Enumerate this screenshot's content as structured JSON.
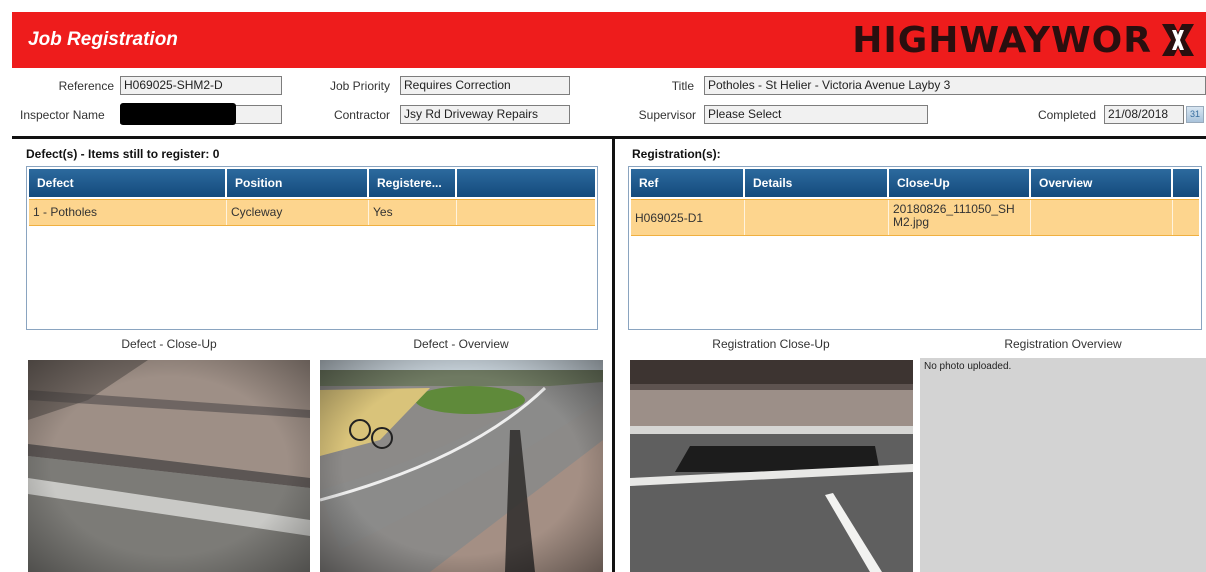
{
  "header": {
    "title": "Job Registration",
    "logo_text": "HIGHWAYWOR"
  },
  "form": {
    "reference_label": "Reference",
    "reference_value": "H069025-SHM2-D",
    "inspector_label": "Inspector Name",
    "priority_label": "Job Priority",
    "priority_value": "Requires Correction",
    "contractor_label": "Contractor",
    "contractor_value": "Jsy Rd Driveway Repairs",
    "title_label": "Title",
    "title_value": "Potholes - St Helier - Victoria Avenue Layby 3",
    "supervisor_label": "Supervisor",
    "supervisor_value": "Please Select",
    "completed_label": "Completed",
    "completed_value": "21/08/2018",
    "calendar_glyph": "31"
  },
  "defects": {
    "title": "Defect(s) - Items still to register: 0",
    "columns": [
      "Defect",
      "Position",
      "Registere..."
    ],
    "rows": [
      {
        "defect": "1 - Potholes",
        "position": "Cycleway",
        "registered": "Yes"
      }
    ],
    "closeup_caption": "Defect - Close-Up",
    "overview_caption": "Defect - Overview"
  },
  "registrations": {
    "title": "Registration(s):",
    "columns": [
      "Ref",
      "Details",
      "Close-Up",
      "Overview"
    ],
    "rows": [
      {
        "ref": "H069025-D1",
        "details": "",
        "closeup": "20180826_111050_SH M2.jpg",
        "overview": ""
      }
    ],
    "closeup_caption": "Registration Close-Up",
    "overview_caption": "Registration Overview",
    "no_photo_text": "No photo uploaded."
  },
  "colors": {
    "header_red": "#ee1c1c",
    "grid_header_blue": "#1d5a8c",
    "row_highlight": "#fdd58e"
  }
}
